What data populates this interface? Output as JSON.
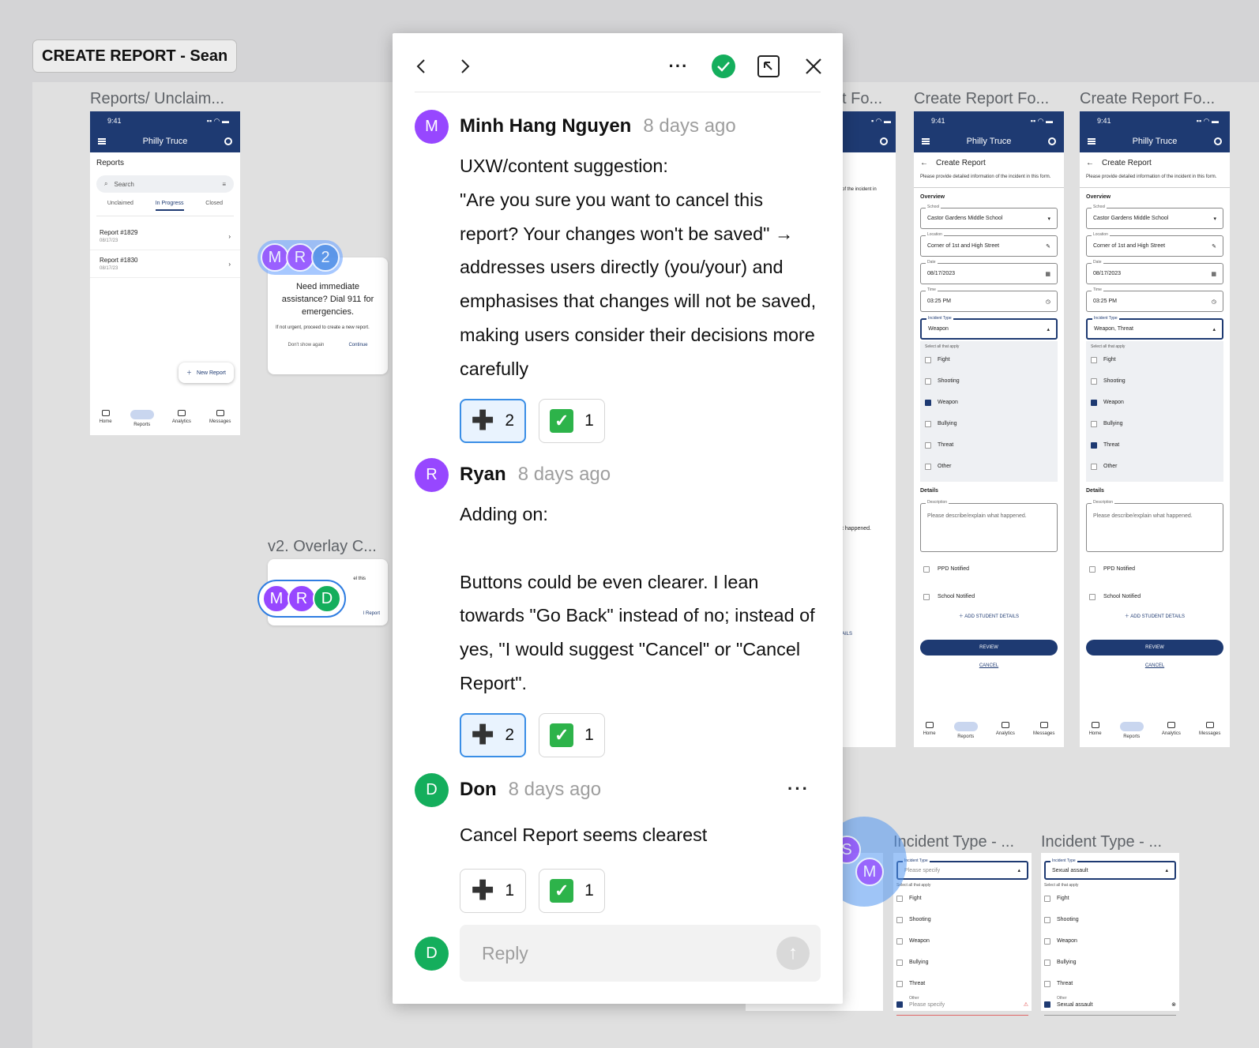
{
  "section": {
    "label": "CREATE REPORT - Sean"
  },
  "frames": {
    "reports": "Reports/ Unclaim...",
    "overlay": "v2. Overlay C...",
    "create_partial": "t Fo...",
    "create1": "Create Report Fo...",
    "create2": "Create Report Fo...",
    "incident1": "Incident Type - ...",
    "incident2": "Incident Type - ...",
    "partial_s": "S ..."
  },
  "phone": {
    "time": "9:41",
    "app_title": "Philly Truce",
    "reports_heading": "Reports",
    "search_placeholder": "Search",
    "tabs": [
      "Unclaimed",
      "In Progress",
      "Closed"
    ],
    "rows": [
      {
        "title": "Report #1829",
        "date": "08/17/23"
      },
      {
        "title": "Report #1830",
        "date": "08/17/23"
      }
    ],
    "new_report": "New Report",
    "nav": [
      "Home",
      "Reports",
      "Analytics",
      "Messages"
    ]
  },
  "dialog": {
    "title": "Need immediate assistance? Dial 911 for emergencies.",
    "body": "If not urgent, proceed to create a new report.",
    "dont_show": "Don't show again",
    "continue": "Continue",
    "overlay_snip1": "el this",
    "overlay_snip2": "l Report"
  },
  "form": {
    "back_title": "Create Report",
    "desc": "Please provide detailed information of the incident in this form.",
    "overview": "Overview",
    "school_label": "School",
    "school": "Castor Gardens Middle School",
    "location_label": "Location",
    "location": "Corner of 1st and High Street",
    "date_label": "Date",
    "date": "08/17/2023",
    "time_label": "Time",
    "time": "03:25 PM",
    "incident_label": "Incident Type",
    "incident_value_1": "Weapon",
    "incident_value_2": "Weapon, Threat",
    "select_hint": "Select all that apply",
    "options": [
      "Fight",
      "Shooting",
      "Weapon",
      "Bullying",
      "Threat",
      "Other"
    ],
    "details": "Details",
    "description_label": "Description",
    "description_ph": "Please describe/explain what happened.",
    "ppd": "PPD Notified",
    "school_notified": "School Notified",
    "add_student": "ADD STUDENT DETAILS",
    "review": "REVIEW",
    "cancel": "CANCEL",
    "partial_happened": "t happened.",
    "partial_incident_desc": "of the incident in",
    "partial_tails": "AILS"
  },
  "incident_cards": {
    "label": "Incident Type",
    "value_1": "Please specify",
    "value_2": "Sexual assault",
    "select_hint": "Select all that apply",
    "options": [
      "Fight",
      "Shooting",
      "Weapon",
      "Bullying",
      "Threat"
    ],
    "other_label": "Other",
    "other_1": "Please specify",
    "other_2": "Sexual assault"
  },
  "presence": {
    "group1": [
      "M",
      "R",
      "2"
    ],
    "group2": [
      "M",
      "R",
      "D"
    ],
    "group3": [
      "S",
      "M"
    ]
  },
  "thread": {
    "comments": [
      {
        "initial": "M",
        "author": "Minh Hang Nguyen",
        "time": "8 days ago",
        "body": "UXW/content suggestion:\n\"Are you sure you want to cancel this report? Your changes won't be saved\" → addresses users directly (you/your) and emphasises that changes will not be saved, making users consider their decisions more carefully",
        "plus_count": "2",
        "check_count": "1"
      },
      {
        "initial": "R",
        "author": "Ryan",
        "time": "8 days ago",
        "body": "Adding on:\n\nButtons could be even clearer. I lean towards \"Go Back\" instead of no; instead of yes, \"I would suggest \"Cancel\" or \"Cancel Report\".",
        "plus_count": "2",
        "check_count": "1"
      },
      {
        "initial": "D",
        "author": "Don",
        "time": "8 days ago",
        "body": "Cancel Report seems clearest",
        "plus_count": "1",
        "check_count": "1"
      }
    ],
    "reply_initial": "D",
    "reply_placeholder": "Reply"
  },
  "colors": {
    "purple_avatar": "#9747ff",
    "green_avatar": "#14ae5c",
    "app_blue": "#1e3a72",
    "resolve_green": "#14ae5c",
    "reaction_selected": "#3a8ee6"
  },
  "icons": [
    "chevron-left-icon",
    "chevron-right-icon",
    "more-icon",
    "resolve-check-icon",
    "collapse-icon",
    "close-icon",
    "send-arrow-icon",
    "plus-one-icon",
    "check-mark-icon"
  ]
}
